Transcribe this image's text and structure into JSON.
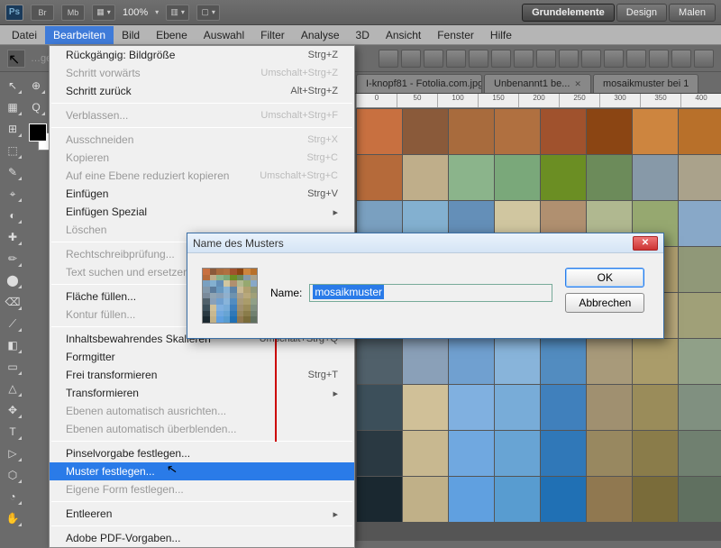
{
  "top": {
    "logo": "Ps",
    "br": "Br",
    "mb": "Mb",
    "zoom": "100%"
  },
  "workspace": {
    "active": "Grundelemente",
    "items": [
      "Design",
      "Malen"
    ]
  },
  "menubar": [
    "Datei",
    "Bearbeiten",
    "Bild",
    "Ebene",
    "Auswahl",
    "Filter",
    "Analyse",
    "3D",
    "Ansicht",
    "Fenster",
    "Hilfe"
  ],
  "open_menu_index": 1,
  "tabs": [
    {
      "label": "I-knopf81 - Fotolia.com.jpg",
      "closable": true
    },
    {
      "label": "Unbenannt1 be...",
      "closable": true
    },
    {
      "label": "mosaikmuster bei 1",
      "closable": false
    }
  ],
  "ruler": [
    "0",
    "50",
    "100",
    "150",
    "200",
    "250",
    "300",
    "350",
    "400"
  ],
  "tools": [
    "↖",
    "▦",
    "⊞",
    "⬚",
    "✎",
    "⌖",
    "◐",
    "✚",
    "✏",
    "⬤",
    "⌫",
    "⟋",
    "◧",
    "▭",
    "△",
    "✥",
    "T",
    "▷",
    "⬡",
    "◔",
    "✋",
    "⊕",
    "Q"
  ],
  "dropdown": [
    {
      "type": "item",
      "label": "Rückgängig: Bildgröße",
      "shortcut": "Strg+Z"
    },
    {
      "type": "item",
      "label": "Schritt vorwärts",
      "shortcut": "Umschalt+Strg+Z",
      "disabled": true
    },
    {
      "type": "item",
      "label": "Schritt zurück",
      "shortcut": "Alt+Strg+Z"
    },
    {
      "type": "sep"
    },
    {
      "type": "item",
      "label": "Verblassen...",
      "shortcut": "Umschalt+Strg+F",
      "disabled": true
    },
    {
      "type": "sep"
    },
    {
      "type": "item",
      "label": "Ausschneiden",
      "shortcut": "Strg+X",
      "disabled": true
    },
    {
      "type": "item",
      "label": "Kopieren",
      "shortcut": "Strg+C",
      "disabled": true
    },
    {
      "type": "item",
      "label": "Auf eine Ebene reduziert kopieren",
      "shortcut": "Umschalt+Strg+C",
      "disabled": true
    },
    {
      "type": "item",
      "label": "Einfügen",
      "shortcut": "Strg+V"
    },
    {
      "type": "item",
      "label": "Einfügen Spezial",
      "submenu": true
    },
    {
      "type": "item",
      "label": "Löschen",
      "disabled": true
    },
    {
      "type": "sep"
    },
    {
      "type": "item",
      "label": "Rechtschreibprüfung...",
      "disabled": true
    },
    {
      "type": "item",
      "label": "Text suchen und ersetzen...",
      "disabled": true
    },
    {
      "type": "sep"
    },
    {
      "type": "item",
      "label": "Fläche füllen..."
    },
    {
      "type": "item",
      "label": "Kontur füllen...",
      "disabled": true
    },
    {
      "type": "sep"
    },
    {
      "type": "item",
      "label": "Inhaltsbewahrendes Skalieren",
      "shortcut": "Umschalt+Strg+Q"
    },
    {
      "type": "item",
      "label": "Formgitter"
    },
    {
      "type": "item",
      "label": "Frei transformieren",
      "shortcut": "Strg+T"
    },
    {
      "type": "item",
      "label": "Transformieren",
      "submenu": true
    },
    {
      "type": "item",
      "label": "Ebenen automatisch ausrichten...",
      "disabled": true
    },
    {
      "type": "item",
      "label": "Ebenen automatisch überblenden...",
      "disabled": true
    },
    {
      "type": "sep"
    },
    {
      "type": "item",
      "label": "Pinselvorgabe festlegen..."
    },
    {
      "type": "item",
      "label": "Muster festlegen...",
      "highlight": true
    },
    {
      "type": "item",
      "label": "Eigene Form festlegen...",
      "disabled": true
    },
    {
      "type": "sep"
    },
    {
      "type": "item",
      "label": "Entleeren",
      "submenu": true
    },
    {
      "type": "sep"
    },
    {
      "type": "item",
      "label": "Adobe PDF-Vorgaben..."
    }
  ],
  "dialog": {
    "title": "Name des Musters",
    "name_label": "Name:",
    "name_value": "mosaikmuster",
    "ok": "OK",
    "cancel": "Abbrechen"
  },
  "mosaic_colors": [
    "#c87040",
    "#8a5a3a",
    "#a86b3d",
    "#b07040",
    "#a0522d",
    "#8b4513",
    "#cd853f",
    "#b8702a",
    "#b56a3a",
    "#bfae8a",
    "#8bb48b",
    "#7aa87a",
    "#6b8e23",
    "#6c8b5a",
    "#8799a8",
    "#aaa28b",
    "#7aa0c0",
    "#83b0d0",
    "#648fb8",
    "#d0c6a0",
    "#b09070",
    "#b0b890",
    "#96a870",
    "#88a8c8",
    "#8298aa",
    "#5c7c9c",
    "#6899c0",
    "#87b2d5",
    "#5c84a8",
    "#c9ba96",
    "#b0a070",
    "#909878",
    "#7a8a9a",
    "#91a5b4",
    "#88a0b8",
    "#90b0cd",
    "#6e93af",
    "#aaa08a",
    "#b8a87b",
    "#a0a078",
    "#50606a",
    "#8aa0b8",
    "#70a0d0",
    "#88b4da",
    "#528cc0",
    "#a89a7a",
    "#aa9c6a",
    "#90a088",
    "#3c4f5a",
    "#d0c098",
    "#80b0e0",
    "#78acd8",
    "#4080bc",
    "#a09070",
    "#9a8c5a",
    "#809080",
    "#2a3942",
    "#c8b890",
    "#70a8e0",
    "#68a4d4",
    "#3078b8",
    "#988860",
    "#8a7c4a",
    "#708070",
    "#1a2830",
    "#c0b088",
    "#60a0e0",
    "#589cd0",
    "#2070b4",
    "#907850",
    "#7a6c3a",
    "#607060"
  ]
}
